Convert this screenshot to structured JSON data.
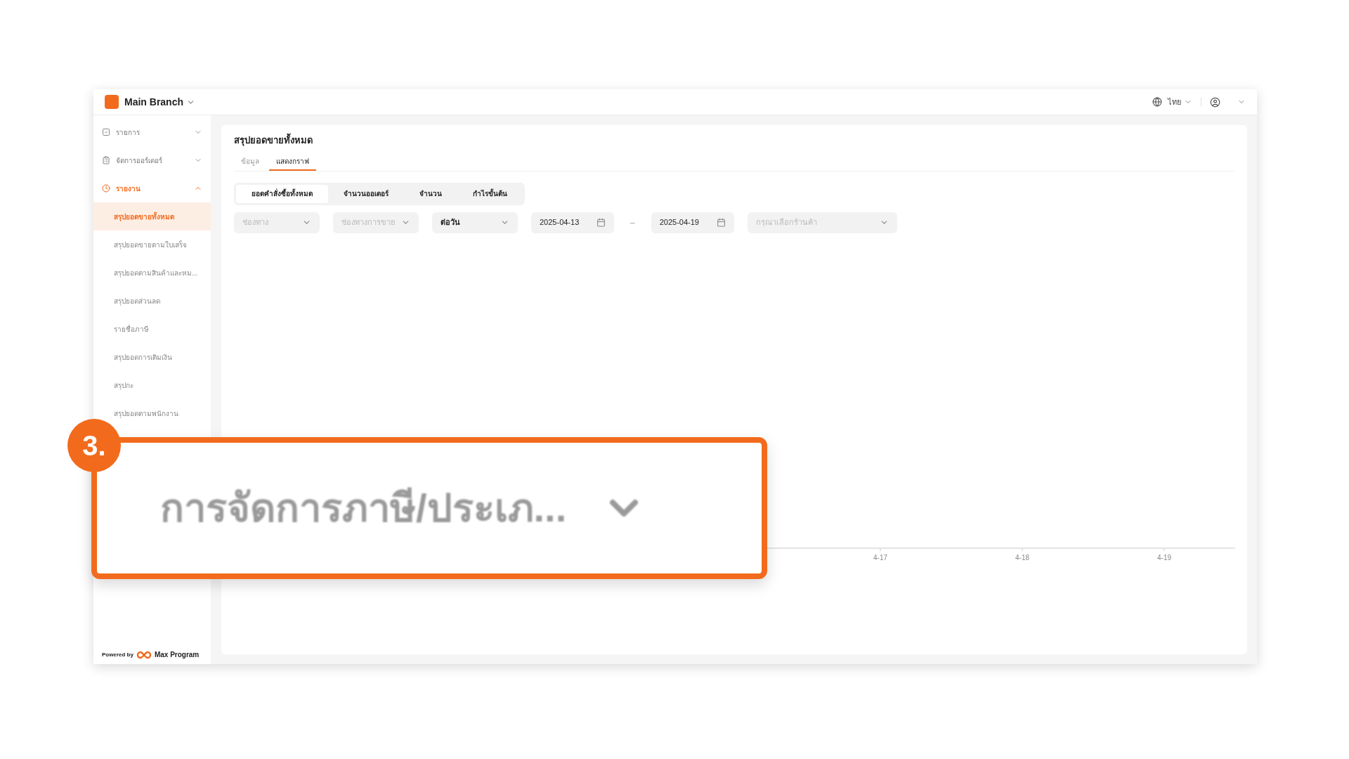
{
  "header": {
    "branch": "Main Branch",
    "language": "ไทย"
  },
  "sidebar": {
    "groups": [
      {
        "label": "รายการ",
        "expanded": false,
        "selected": false
      },
      {
        "label": "จัดการออร์เดอร์",
        "expanded": false,
        "selected": false
      },
      {
        "label": "รายงาน",
        "expanded": true,
        "selected": true,
        "children": [
          {
            "label": "สรุปยอดขายทั้งหมด",
            "selected": true
          },
          {
            "label": "สรุปยอดขายตามใบเสร็จ",
            "selected": false
          },
          {
            "label": "สรุปยอดตามสินค้าและหม...",
            "selected": false
          },
          {
            "label": "สรุปยอดส่วนลด",
            "selected": false
          },
          {
            "label": "รายชื่อภาษี",
            "selected": false
          },
          {
            "label": "สรุปยอดการเติมเงิน",
            "selected": false
          },
          {
            "label": "สรุปกะ",
            "selected": false
          },
          {
            "label": "สรุปยอดตามพนักงาน",
            "selected": false
          }
        ]
      }
    ],
    "footer": {
      "powered_by": "Powered by",
      "brand": "Max Program"
    }
  },
  "page": {
    "title": "สรุปยอดขายทั้งหมด",
    "tabs": [
      {
        "label": "ข้อมูล",
        "selected": false
      },
      {
        "label": "แสดงกราฟ",
        "selected": true
      }
    ],
    "metric_tabs": [
      {
        "label": "ยอดคำสั่งซื้อทั้งหมด",
        "selected": true
      },
      {
        "label": "จำนวนออเดอร์",
        "selected": false
      },
      {
        "label": "จำนวน",
        "selected": false
      },
      {
        "label": "กำไรขั้นต้น",
        "selected": false
      }
    ],
    "filters": [
      {
        "kind": "select",
        "placeholder": "ช่องทาง"
      },
      {
        "kind": "select",
        "placeholder": "ช่องทางการขาย"
      },
      {
        "kind": "select",
        "value": "ต่อวัน"
      },
      {
        "kind": "date",
        "value": "2025-04-13"
      },
      {
        "kind": "separator",
        "text": "–"
      },
      {
        "kind": "date",
        "value": "2025-04-19"
      },
      {
        "kind": "select",
        "placeholder": "กรุณาเลือกร้านค้า"
      }
    ],
    "chart": {
      "x_labels": [
        "4-17",
        "4-18",
        "4-19"
      ]
    }
  },
  "callout": {
    "number": "3.",
    "text": "การจัดการภาษี/ประเภ..."
  }
}
